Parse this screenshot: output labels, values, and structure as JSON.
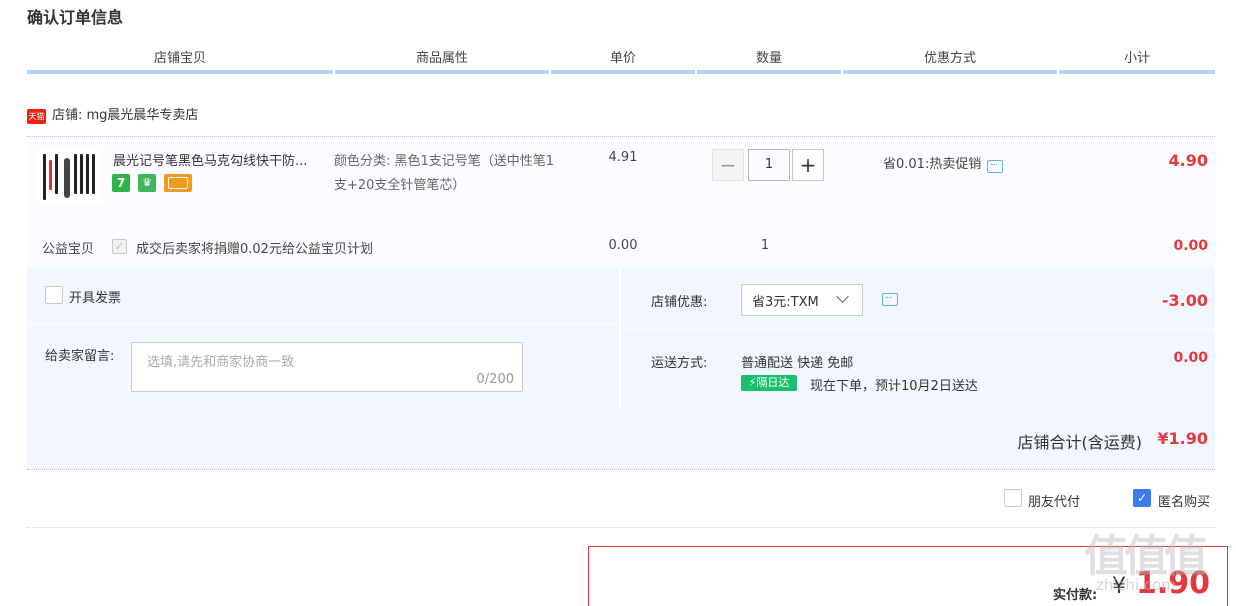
{
  "page_title": "确认订单信息",
  "columns": [
    "店铺宝贝",
    "商品属性",
    "单价",
    "数量",
    "优惠方式",
    "小计"
  ],
  "shop": {
    "badge": "天猫",
    "name": "店铺: mg晨光晨华专卖店"
  },
  "item": {
    "name": "晨光记号笔黑色马克勾线快干防...",
    "attr": "颜色分类: 黑色1支记号笔（送中性笔1支+20支全针管笔芯）",
    "price": "4.91",
    "qty_minus": "−",
    "qty": "1",
    "qty_plus": "+",
    "promo": "省0.01:热卖促销",
    "subtotal": "4.90",
    "badge_text": "7"
  },
  "charity": {
    "label": "公益宝贝",
    "text": "成交后卖家将捐赠0.02元给公益宝贝计划",
    "price": "0.00",
    "qty": "1",
    "subtotal": "0.00"
  },
  "invoice": {
    "label": "开具发票"
  },
  "message": {
    "label": "给卖家留言:",
    "placeholder": "选填,请先和商家协商一致",
    "count": "0/200"
  },
  "shop_discount": {
    "label": "店铺优惠:",
    "selected": "省3元:TXM",
    "amount": "-3.00"
  },
  "shipping": {
    "label": "运送方式:",
    "method": "普通配送 快递 免邮",
    "badge": "隔日达",
    "eta": "现在下单，预计10月2日送达",
    "amount": "0.00"
  },
  "shop_total": {
    "label": "店铺合计(含运费)",
    "amount": "¥1.90"
  },
  "options": {
    "friend_pay": "朋友代付",
    "anonymous": "匿名购买"
  },
  "payment": {
    "label": "实付款:",
    "yen": "¥",
    "amount": "1.90"
  },
  "watermark": {
    "main": "值值值",
    "sub": "zhizhi.com"
  },
  "colors": {
    "accent_red": "#e4393c",
    "header_bar": "#b2d1ff",
    "panel_bg": "#f2f7ff",
    "checkbox_blue": "#3d7bed"
  }
}
